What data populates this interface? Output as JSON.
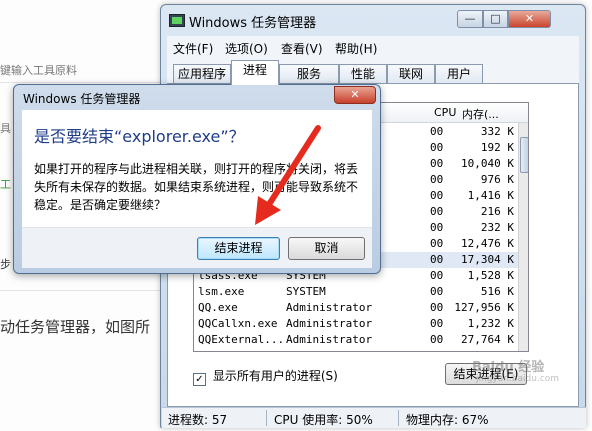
{
  "background": {
    "line1": "键输入工具原料",
    "line2": "具",
    "line3": "工",
    "line4": "步",
    "instruction": "动任务管理器，如图所"
  },
  "task_manager": {
    "title": "Windows 任务管理器",
    "controls": {
      "minimize": "—",
      "maximize": "□",
      "close": "✕"
    },
    "menu": [
      "文件(F)",
      "选项(O)",
      "查看(V)",
      "帮助(H)"
    ],
    "tabs": [
      "应用程序",
      "进程",
      "服务",
      "性能",
      "联网",
      "用户"
    ],
    "active_tab": "进程",
    "columns": {
      "cpu": "CPU",
      "memory": "内存(..."
    },
    "rows": [
      {
        "name": "",
        "user": "",
        "cpu": "00",
        "mem": "332 K"
      },
      {
        "name": "",
        "user": "",
        "cpu": "00",
        "mem": "192 K"
      },
      {
        "name": "",
        "user": "",
        "cpu": "00",
        "mem": "10,040 K"
      },
      {
        "name": "",
        "user": "",
        "cpu": "00",
        "mem": "976 K"
      },
      {
        "name": "",
        "user": "",
        "cpu": "00",
        "mem": "1,416 K"
      },
      {
        "name": "",
        "user": "",
        "cpu": "00",
        "mem": "216 K"
      },
      {
        "name": "",
        "user": "",
        "cpu": "00",
        "mem": "232 K"
      },
      {
        "name": "",
        "user": "",
        "cpu": "00",
        "mem": "12,476 K"
      },
      {
        "name": "",
        "user": "",
        "cpu": "00",
        "mem": "17,304 K"
      },
      {
        "name": "lsass.exe",
        "user": "SYSTEM",
        "cpu": "00",
        "mem": "1,528 K"
      },
      {
        "name": "lsm.exe",
        "user": "SYSTEM",
        "cpu": "00",
        "mem": "516 K"
      },
      {
        "name": "QQ.exe",
        "user": "Administrator",
        "cpu": "00",
        "mem": "127,956 K"
      },
      {
        "name": "QQCallxn.exe",
        "user": "Administrator",
        "cpu": "00",
        "mem": "1,232 K"
      },
      {
        "name": "QQExternal...",
        "user": "Administrator",
        "cpu": "00",
        "mem": "27,764 K"
      }
    ],
    "show_all_label": "显示所有用户的进程(S)",
    "end_process_label": "结束进程(E)",
    "status": {
      "processes": "进程数: 57",
      "cpu": "CPU 使用率: 50%",
      "memory": "物理内存: 67%"
    }
  },
  "dialog": {
    "title": "Windows 任务管理器",
    "close": "✕",
    "heading": "是否要结束“explorer.exe”？",
    "message": "如果打开的程序与此进程相关联，则打开的程序将关闭，将丢失所有未保存的数据。如果结束系统进程，则可能导致系统不稳定。是否确定要继续？",
    "confirm_label": "结束进程",
    "cancel_label": "取消"
  },
  "watermark": {
    "text": "Baidu 经验",
    "sub": "jingyan.baidu.com"
  },
  "colors": {
    "arrow": "#e52b1e",
    "heading": "#1f3c88"
  }
}
